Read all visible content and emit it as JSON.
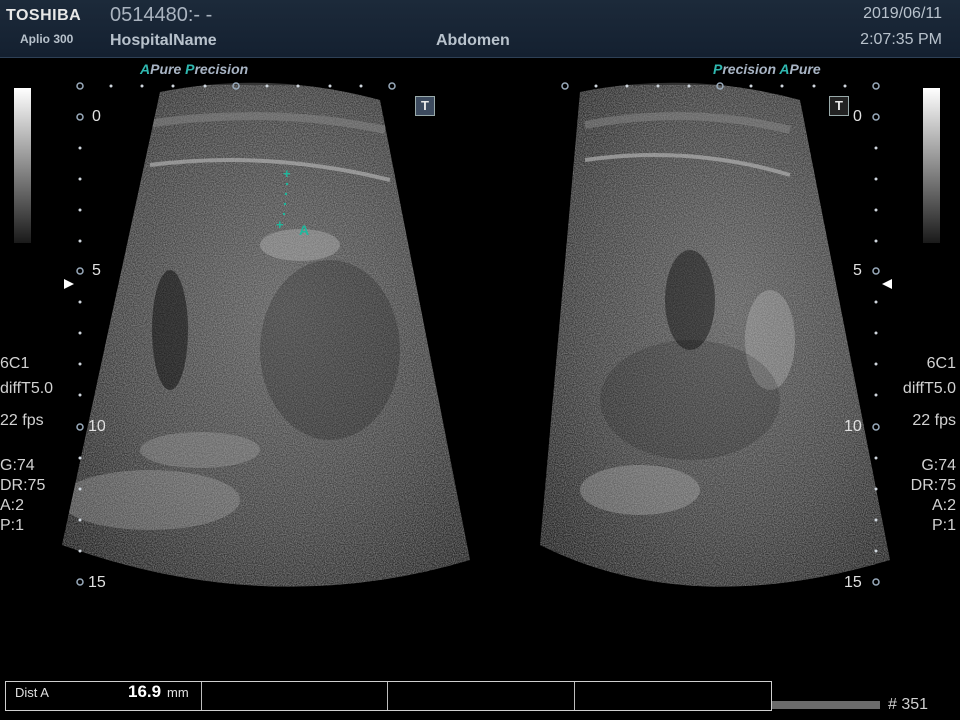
{
  "header": {
    "brand": "TOSHIBA",
    "model": "Aplio 300",
    "patient_id": "0514480:- -",
    "hospital": "HospitalName",
    "exam": "Abdomen",
    "date": "2019/06/11",
    "time": "2:07:35 PM"
  },
  "logos": {
    "left": {
      "a": "A",
      "pure": "Pure",
      "p": "P",
      "recision": "recision"
    },
    "right": {
      "p": "P",
      "recision": "recision",
      "a": "A",
      "pure": "Pure"
    }
  },
  "depth_scale": {
    "left": [
      "0",
      "5",
      "10",
      "15"
    ],
    "right": [
      "0",
      "5",
      "10",
      "15"
    ]
  },
  "left_params": {
    "probe": "6C1",
    "mode": "diffT5.0",
    "fps": "22 fps",
    "gain": "G:74",
    "dr": "DR:75",
    "a": "A:2",
    "p": "P:1"
  },
  "right_params": {
    "probe": "6C1",
    "mode": "diffT5.0",
    "fps": "22 fps",
    "gain": "G:74",
    "dr": "DR:75",
    "a": "A:2",
    "p": "P:1"
  },
  "buttons": {
    "t_left": "T",
    "t_right": "T"
  },
  "caliper": {
    "label": "A"
  },
  "measurement": {
    "label": "Dist A",
    "value": "16.9",
    "unit": "mm"
  },
  "frame": "# 351",
  "colors": {
    "header_bg": "#142030",
    "caliper": "#1fb89d",
    "marker": "#7ea7e0",
    "logo_accent": "#2fb8b0"
  }
}
